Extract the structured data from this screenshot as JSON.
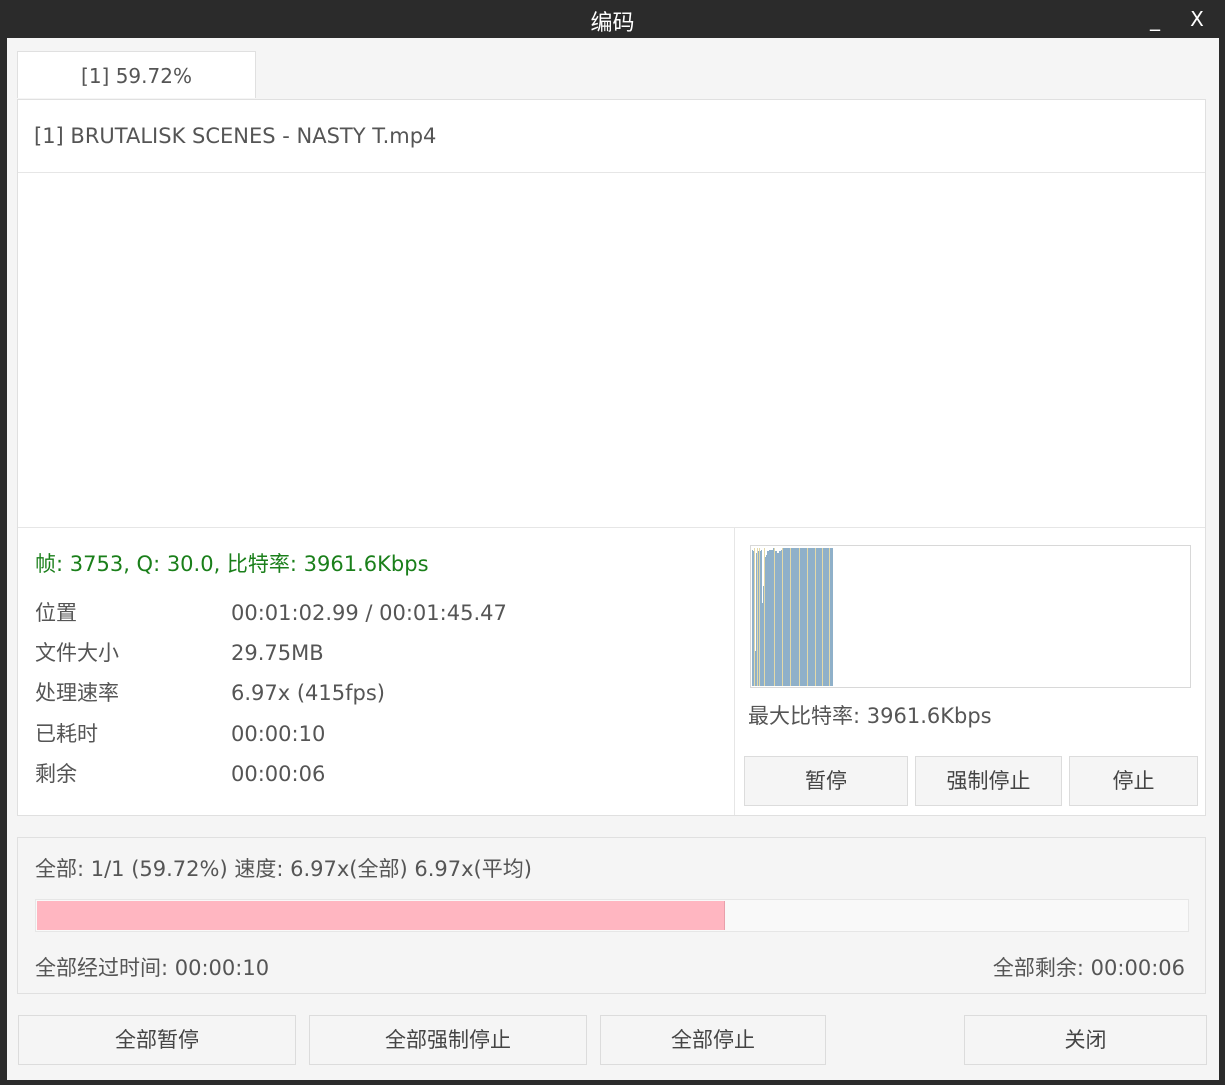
{
  "window": {
    "title": "编码",
    "minimize_label": "_",
    "close_label": "X"
  },
  "tab": {
    "label": "[1] 59.72%"
  },
  "job": {
    "filename": "[1] BRUTALISK SCENES - NASTY T.mp4",
    "stats_line": "帧: 3753, Q: 30.0, 比特率: 3961.6Kbps",
    "stats": [
      {
        "label": "位置",
        "value": "00:01:02.99 / 00:01:45.47"
      },
      {
        "label": "文件大小",
        "value": "29.75MB"
      },
      {
        "label": "处理速率",
        "value": "6.97x (415fps)"
      },
      {
        "label": "已耗时",
        "value": "00:00:10"
      },
      {
        "label": "剩余",
        "value": "00:00:06"
      }
    ],
    "max_bitrate": "最大比特率: 3961.6Kbps",
    "buttons": {
      "pause": "暂停",
      "force_stop": "强制停止",
      "stop": "停止"
    }
  },
  "bitrate_graph": {
    "bar_color": "#8fb0c9",
    "gap_color": "#e3d9a8",
    "values": [
      0.98,
      0.97,
      0.97,
      0.25,
      0.96,
      0.96,
      0.97,
      0.97,
      0.97,
      0.98,
      0.6,
      0.72,
      0.88,
      0.93,
      0.94,
      0.97,
      0.97,
      0.98,
      0.98,
      0.98,
      0.98,
      0.99,
      0.98,
      0.97,
      0.97,
      0.96,
      0.96,
      0.97,
      0.97,
      0.98,
      0.98,
      0.99,
      0.99,
      0.99,
      0.99,
      0.99,
      0.99,
      0.99,
      0.99,
      0.99,
      0.99,
      0.99,
      0.99,
      0.99,
      0.99,
      0.99,
      0.99,
      0.99,
      0.99,
      0.99,
      0.99,
      0.99,
      0.99,
      0.99,
      0.99,
      0.99,
      0.99,
      0.99,
      0.99,
      0.99,
      0.99,
      0.99,
      0.99,
      0.99,
      0.99,
      0.99,
      0.99,
      0.99,
      0.99,
      0.99,
      0.99,
      0.99,
      0.99,
      0.99,
      0.99,
      0.99,
      0.99,
      0.99,
      0.99,
      0.99,
      0.99
    ],
    "gaps": [
      2,
      5,
      7,
      12,
      22,
      30,
      38,
      47,
      55,
      63,
      70,
      77
    ]
  },
  "overall": {
    "summary": "全部: 1/1 (59.72%) 速度: 6.97x(全部) 6.97x(平均)",
    "progress": 0.5972,
    "progress_color": "#ffb6c1",
    "elapsed": "全部经过时间: 00:00:10",
    "remaining": "全部剩余: 00:00:06"
  },
  "bottom_buttons": {
    "pause_all": "全部暂停",
    "force_stop_all": "全部强制停止",
    "stop_all": "全部停止",
    "close": "关闭"
  }
}
